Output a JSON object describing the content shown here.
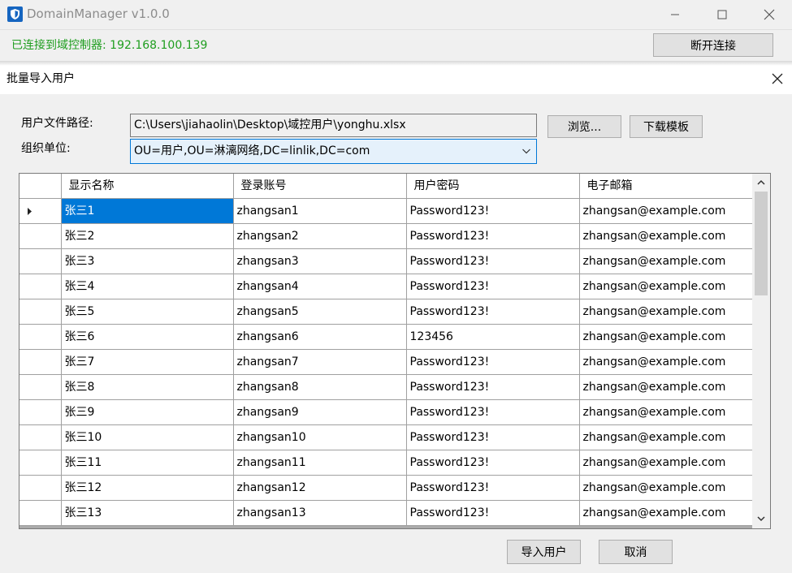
{
  "window": {
    "title": "DomainManager v1.0.0"
  },
  "status": {
    "text": "已连接到域控制器: 192.168.100.139",
    "disconnect_label": "断开连接",
    "color": "#1f9e1f"
  },
  "dialog": {
    "title": "批量导入用户",
    "file_path_label": "用户文件路径:",
    "file_path_value": "C:\\Users\\jiahaolin\\Desktop\\域控用户\\yonghu.xlsx",
    "browse_label": "浏览...",
    "download_template_label": "下载模板",
    "ou_label": "组织单位:",
    "ou_value": "OU=用户,OU=淋漓网络,DC=linlik,DC=com",
    "import_label": "导入用户",
    "cancel_label": "取消"
  },
  "grid": {
    "columns": [
      "显示名称",
      "登录账号",
      "用户密码",
      "电子邮箱"
    ],
    "selected_row": 0,
    "rows": [
      [
        "张三1",
        "zhangsan1",
        "Password123!",
        "zhangsan@example.com"
      ],
      [
        "张三2",
        "zhangsan2",
        "Password123!",
        "zhangsan@example.com"
      ],
      [
        "张三3",
        "zhangsan3",
        "Password123!",
        "zhangsan@example.com"
      ],
      [
        "张三4",
        "zhangsan4",
        "Password123!",
        "zhangsan@example.com"
      ],
      [
        "张三5",
        "zhangsan5",
        "Password123!",
        "zhangsan@example.com"
      ],
      [
        "张三6",
        "zhangsan6",
        "123456",
        "zhangsan@example.com"
      ],
      [
        "张三7",
        "zhangsan7",
        "Password123!",
        "zhangsan@example.com"
      ],
      [
        "张三8",
        "zhangsan8",
        "Password123!",
        "zhangsan@example.com"
      ],
      [
        "张三9",
        "zhangsan9",
        "Password123!",
        "zhangsan@example.com"
      ],
      [
        "张三10",
        "zhangsan10",
        "Password123!",
        "zhangsan@example.com"
      ],
      [
        "张三11",
        "zhangsan11",
        "Password123!",
        "zhangsan@example.com"
      ],
      [
        "张三12",
        "zhangsan12",
        "Password123!",
        "zhangsan@example.com"
      ],
      [
        "张三13",
        "zhangsan13",
        "Password123!",
        "zhangsan@example.com"
      ]
    ]
  },
  "icons": {
    "app": "shield-icon",
    "minimize": "minimize-icon",
    "maximize": "maximize-icon",
    "close": "close-icon",
    "row_pointer": "row-pointer-icon",
    "scroll_up": "scroll-up-arrow-icon",
    "scroll_down": "scroll-down-arrow-icon",
    "combo": "chevron-down-icon"
  }
}
